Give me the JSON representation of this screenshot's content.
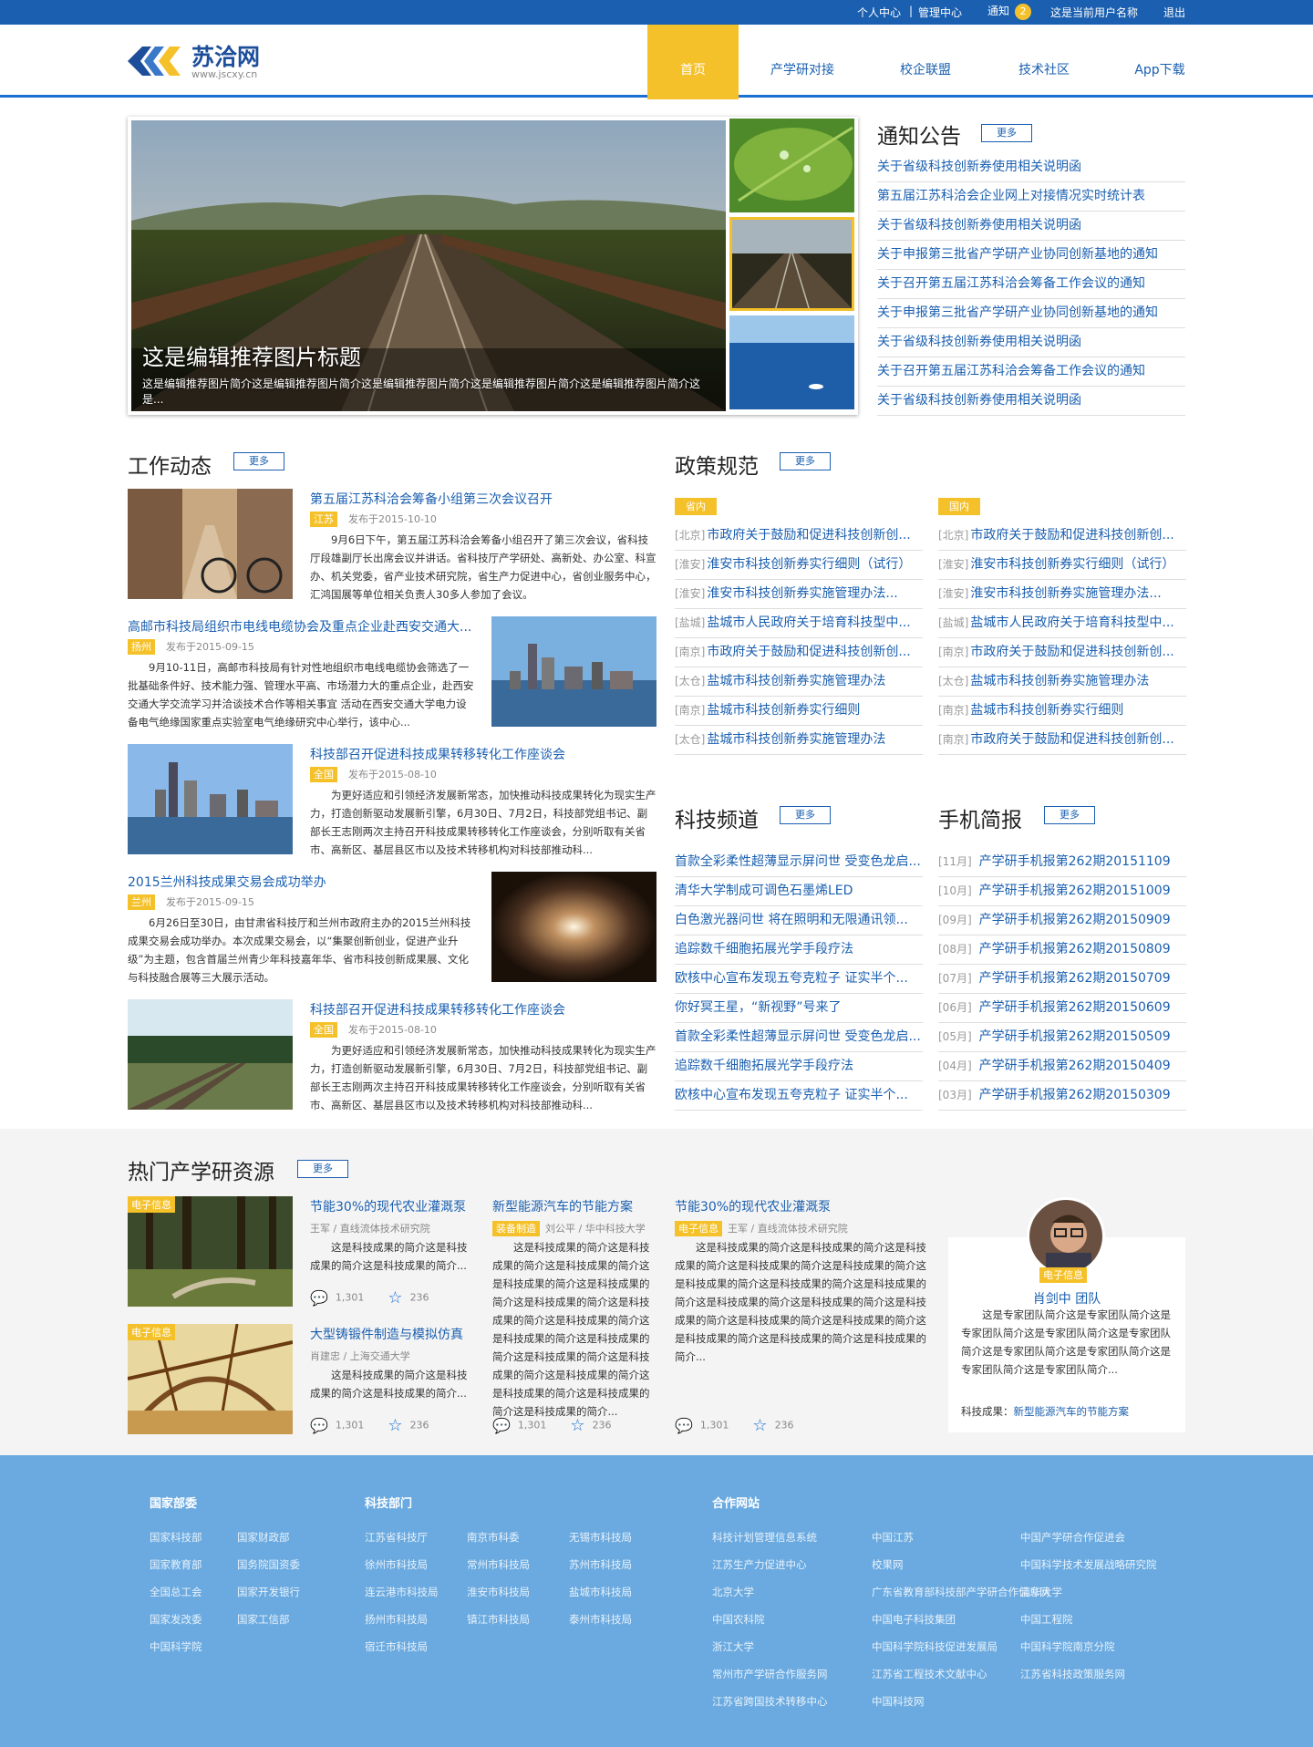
{
  "topbar": {
    "personal_center": "个人中心",
    "separator": "|",
    "admin_center": "管理中心",
    "notice": "通知",
    "notice_count": "2",
    "username": "这是当前用户名称",
    "logout": "退出"
  },
  "logo": {
    "title": "苏洽网",
    "domain": "www.jscxy.cn"
  },
  "nav": [
    "首页",
    "产学研对接",
    "校企联盟",
    "技术社区",
    "App下载"
  ],
  "hero": {
    "title": "这是编辑推荐图片标题",
    "desc": "这是编辑推荐图片简介这是编辑推荐图片简介这是编辑推荐图片简介这是编辑推荐图片简介这是编辑推荐图片简介这是..."
  },
  "notices": {
    "title": "通知公告",
    "more": "更多",
    "items": [
      "关于省级科技创新券使用相关说明函",
      "第五届江苏科洽会企业网上对接情况实时统计表",
      "关于省级科技创新券使用相关说明函",
      "关于申报第三批省产学研产业协同创新基地的通知",
      "关于召开第五届江苏科洽会筹备工作会议的通知",
      "关于申报第三批省产学研产业协同创新基地的通知",
      "关于省级科技创新券使用相关说明函",
      "关于召开第五届江苏科洽会筹备工作会议的通知",
      "关于省级科技创新券使用相关说明函"
    ]
  },
  "work": {
    "title": "工作动态",
    "more": "更多",
    "items": [
      {
        "title": "第五届江苏科洽会筹备小组第三次会议召开",
        "tag": "江苏",
        "date": "发布于2015-10-10",
        "body": "9月6日下午，第五届江苏科洽会筹备小组召开了第三次会议，省科技厅段雄副厅长出席会议并讲话。省科技厅产学研处、高新处、办公室、科宣办、机关党委，省产业技术研究院，省生产力促进中心，省创业服务中心，汇鸿国展等单位相关负责人30多人参加了会议。"
      },
      {
        "title": "高邮市科技局组织市电线电缆协会及重点企业赴西安交通大...",
        "tag": "扬州",
        "date": "发布于2015-09-15",
        "body": "9月10-11日，高邮市科技局有针对性地组织市电线电缆协会筛选了一批基础条件好、技术能力强、管理水平高、市场潜力大的重点企业，赴西安交通大学交流学习并洽谈技术合作等相关事宜 活动在西安交通大学电力设备电气绝缘国家重点实验室电气绝缘研究中心举行，该中心..."
      },
      {
        "title": "科技部召开促进科技成果转移转化工作座谈会",
        "tag": "全国",
        "date": "发布于2015-08-10",
        "body": "为更好适应和引领经济发展新常态，加快推动科技成果转化为现实生产力，打造创新驱动发展新引擎，6月30日、7月2日，科技部党组书记、副部长王志刚两次主持召开科技成果转移转化工作座谈会，分别听取有关省市、高新区、基层县区市以及技术转移机构对科技部推动科..."
      },
      {
        "title": "2015兰州科技成果交易会成功举办",
        "tag": "兰州",
        "date": "发布于2015-09-15",
        "body": "6月26日至30日，由甘肃省科技厅和兰州市政府主办的2015兰州科技成果交易会成功举办。本次成果交易会，以“集聚创新创业，促进产业升级”为主题，包含首届兰州青少年科技嘉年华、省市科技创新成果展、文化与科技融合展等三大展示活动。"
      },
      {
        "title": "科技部召开促进科技成果转移转化工作座谈会",
        "tag": "全国",
        "date": "发布于2015-08-10",
        "body": "为更好适应和引领经济发展新常态，加快推动科技成果转化为现实生产力，打造创新驱动发展新引擎，6月30日、7月2日，科技部党组书记、副部长王志刚两次主持召开科技成果转移转化工作座谈会，分别听取有关省市、高新区、基层县区市以及技术转移机构对科技部推动科..."
      }
    ]
  },
  "policy": {
    "title": "政策规范",
    "more": "更多",
    "left_tag": "省内",
    "right_tag": "国内",
    "left": [
      {
        "loc": "[北京]",
        "text": "市政府关于鼓励和促进科技创新创..."
      },
      {
        "loc": "[淮安]",
        "text": "淮安市科技创新券实行细则（试行）"
      },
      {
        "loc": "[淮安]",
        "text": "淮安市科技创新券实施管理办法..."
      },
      {
        "loc": "[盐城]",
        "text": "盐城市人民政府关于培育科技型中..."
      },
      {
        "loc": "[南京]",
        "text": "市政府关于鼓励和促进科技创新创..."
      },
      {
        "loc": "[太仓]",
        "text": "盐城市科技创新券实施管理办法"
      },
      {
        "loc": "[南京]",
        "text": "盐城市科技创新券实行细则"
      },
      {
        "loc": "[太仓]",
        "text": "盐城市科技创新券实施管理办法"
      }
    ],
    "right": [
      {
        "loc": "[北京]",
        "text": "市政府关于鼓励和促进科技创新创..."
      },
      {
        "loc": "[淮安]",
        "text": "淮安市科技创新券实行细则（试行）"
      },
      {
        "loc": "[淮安]",
        "text": "淮安市科技创新券实施管理办法..."
      },
      {
        "loc": "[盐城]",
        "text": "盐城市人民政府关于培育科技型中..."
      },
      {
        "loc": "[南京]",
        "text": "市政府关于鼓励和促进科技创新创..."
      },
      {
        "loc": "[太仓]",
        "text": "盐城市科技创新券实施管理办法"
      },
      {
        "loc": "[南京]",
        "text": "盐城市科技创新券实行细则"
      },
      {
        "loc": "[南京]",
        "text": "市政府关于鼓励和促进科技创新创..."
      }
    ]
  },
  "tech": {
    "title": "科技频道",
    "more": "更多",
    "items": [
      "首款全彩柔性超薄显示屏问世 受变色龙启...",
      "清华大学制成可调色石墨烯LED",
      "白色激光器问世 将在照明和无限通讯领...",
      "追踪数千细胞拓展光学手段疗法",
      "欧核中心宣布发现五夸克粒子 证实半个...",
      "你好冥王星，“新视野”号来了",
      "首款全彩柔性超薄显示屏问世 受变色龙启...",
      "追踪数千细胞拓展光学手段疗法",
      "欧核中心宣布发现五夸克粒子 证实半个..."
    ]
  },
  "mobile": {
    "title": "手机简报",
    "more": "更多",
    "items": [
      {
        "m": "[11月]",
        "t": "产学研手机报第262期20151109"
      },
      {
        "m": "[10月]",
        "t": "产学研手机报第262期20151009"
      },
      {
        "m": "[09月]",
        "t": "产学研手机报第262期20150909"
      },
      {
        "m": "[08月]",
        "t": "产学研手机报第262期20150809"
      },
      {
        "m": "[07月]",
        "t": "产学研手机报第262期20150709"
      },
      {
        "m": "[06月]",
        "t": "产学研手机报第262期20150609"
      },
      {
        "m": "[05月]",
        "t": "产学研手机报第262期20150509"
      },
      {
        "m": "[04月]",
        "t": "产学研手机报第262期20150409"
      },
      {
        "m": "[03月]",
        "t": "产学研手机报第262期20150309"
      }
    ]
  },
  "hot": {
    "title": "热门产学研资源",
    "more": "更多",
    "r1": {
      "tag": "电子信息",
      "title": "节能30%的现代农业灌溉泵",
      "meta": "王军 / 直线流体技术研究院",
      "body": "这是科技成果的简介这是科技成果的简介这是科技成果的简介...",
      "comments": "1,301",
      "stars": "236"
    },
    "r2": {
      "tag": "电子信息",
      "title": "大型铸锻件制造与模拟仿真",
      "meta": "肖建忠 / 上海交通大学",
      "body": "这是科技成果的简介这是科技成果的简介这是科技成果的简介...",
      "comments": "1,301",
      "stars": "236"
    },
    "r3": {
      "tag": "装备制造",
      "title": "新型能源汽车的节能方案",
      "meta": "刘公平 / 华中科技大学",
      "body": "这是科技成果的简介这是科技成果的简介这是科技成果的简介这是科技成果的简介这是科技成果的简介这是科技成果的简介这是科技成果的简介这是科技成果的简介这是科技成果的简介这是科技成果的简介这是科技成果的简介这是科技成果的简介这是科技成果的简介这是科技成果的简介这是科技成果的简介这是科技成果的简介...",
      "comments": "1,301",
      "stars": "236"
    },
    "r4": {
      "tag": "电子信息",
      "title": "节能30%的现代农业灌溉泵",
      "meta": "王军 / 直线流体技术研究院",
      "body": "这是科技成果的简介这是科技成果的简介这是科技成果的简介这是科技成果的简介这是科技成果的简介这是科技成果的简介这是科技成果的简介这是科技成果的简介这是科技成果的简介这是科技成果的简介这是科技成果的简介这是科技成果的简介这是科技成果的简介这是科技成果的简介这是科技成果的简介这是科技成果的简介...",
      "comments": "1,301",
      "stars": "236"
    },
    "team": {
      "tag": "电子信息",
      "name": "肖剑中 团队",
      "body": "这是专家团队简介这是专家团队简介这是专家团队简介这是专家团队简介这是专家团队简介这是专家团队简介这是专家团队简介这是专家团队简介这是专家团队简介...",
      "label": "科技成果：",
      "link": "新型能源汽车的节能方案"
    }
  },
  "footer": {
    "col1_title": "国家部委",
    "col1": [
      "国家科技部",
      "国家财政部",
      "国家教育部",
      "国务院国资委",
      "全国总工会",
      "国家开发银行",
      "国家发改委",
      "国家工信部",
      "中国科学院"
    ],
    "col2_title": "科技部门",
    "col2": [
      "江苏省科技厅",
      "南京市科委",
      "无锡市科技局",
      "徐州市科技局",
      "常州市科技局",
      "苏州市科技局",
      "连云港市科技局",
      "淮安市科技局",
      "盐城市科技局",
      "扬州市科技局",
      "镇江市科技局",
      "泰州市科技局",
      "宿迁市科技局"
    ],
    "col3_title": "合作网站",
    "col3": [
      "科技计划管理信息系统",
      "中国江苏",
      "中国产学研合作促进会",
      "江苏生产力促进中心",
      "校果网",
      "中国科学技术发展战略研究院",
      "北京大学",
      "广东省教育部科技部产学研合作信息网",
      "清华大学",
      "中国农科院",
      "中国电子科技集团",
      "中国工程院",
      "浙江大学",
      "中国科学院科技促进发展局",
      "中国科学院南京分院",
      "常州市产学研合作服务网",
      "江苏省工程技术文献中心",
      "江苏省科技政策服务网",
      "江苏省跨国技术转移中心",
      "中国科技网"
    ]
  }
}
